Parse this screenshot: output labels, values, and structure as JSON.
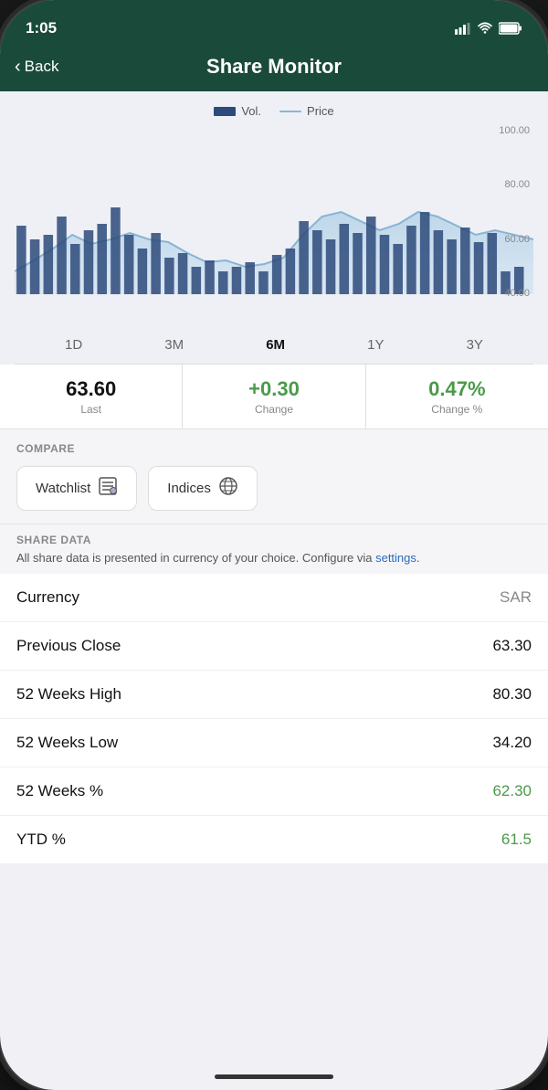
{
  "statusBar": {
    "time": "1:05",
    "signal": "▌▌",
    "wifi": "wifi",
    "battery": "battery"
  },
  "header": {
    "backLabel": "Back",
    "title": "Share Monitor"
  },
  "chart": {
    "legend": {
      "volLabel": "Vol.",
      "priceLabel": "Price"
    },
    "yLabels": [
      "100.00",
      "80.00",
      "60.00",
      "40.00"
    ],
    "periods": [
      {
        "label": "1D",
        "active": false
      },
      {
        "label": "3M",
        "active": false
      },
      {
        "label": "6M",
        "active": true
      },
      {
        "label": "1Y",
        "active": false
      },
      {
        "label": "3Y",
        "active": false
      }
    ]
  },
  "stats": [
    {
      "value": "63.60",
      "label": "Last",
      "green": false
    },
    {
      "value": "+0.30",
      "label": "Change",
      "green": true
    },
    {
      "value": "0.47%",
      "label": "Change %",
      "green": true
    }
  ],
  "compare": {
    "sectionTitle": "COMPARE",
    "buttons": [
      {
        "label": "Watchlist",
        "icon": "📋"
      },
      {
        "label": "Indices",
        "icon": "🌐"
      }
    ]
  },
  "shareData": {
    "sectionTitle": "SHARE DATA",
    "description": "All share data is presented in currency of your choice. Configure via ",
    "settingsLink": "settings",
    "descriptionEnd": "."
  },
  "table": {
    "rows": [
      {
        "label": "Currency",
        "value": "SAR",
        "green": false
      },
      {
        "label": "Previous Close",
        "value": "63.30",
        "green": false
      },
      {
        "label": "52 Weeks High",
        "value": "80.30",
        "green": false
      },
      {
        "label": "52 Weeks Low",
        "value": "34.20",
        "green": false
      },
      {
        "label": "52 Weeks %",
        "value": "62.30",
        "green": true
      },
      {
        "label": "YTD %",
        "value": "61.5",
        "green": true
      }
    ]
  }
}
